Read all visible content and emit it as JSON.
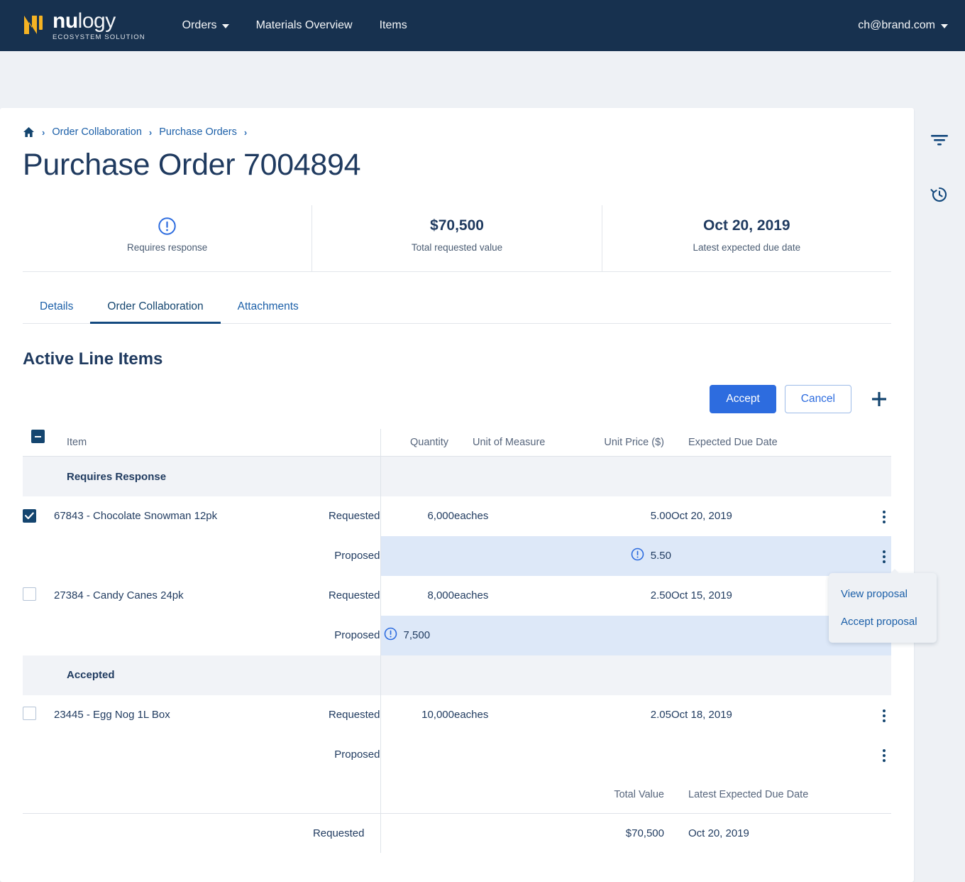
{
  "brand": {
    "name_bold": "nu",
    "name_light": "logy",
    "tagline": "ECOSYSTEM SOLUTION",
    "logo_icon": "nulogy-mark-icon",
    "accent": "#f5b323"
  },
  "topnav": {
    "links": [
      {
        "label": "Orders",
        "has_caret": true
      },
      {
        "label": "Materials Overview",
        "has_caret": false
      },
      {
        "label": "Items",
        "has_caret": false
      }
    ],
    "account": "ch@brand.com",
    "account_caret_icon": "chevron-down-icon",
    "background": "#17314f"
  },
  "breadcrumb": {
    "home_icon": "home-icon",
    "separator": "›",
    "items": [
      "Order Collaboration",
      "Purchase Orders"
    ]
  },
  "page": {
    "title": "Purchase Order 7004894"
  },
  "summary": [
    {
      "icon": "alert-circle-icon",
      "value": "",
      "label": "Requires response"
    },
    {
      "icon": "",
      "value": "$70,500",
      "label": "Total requested value"
    },
    {
      "icon": "",
      "value": "Oct 20, 2019",
      "label": "Latest expected due date"
    }
  ],
  "tabs": [
    {
      "label": "Details",
      "active": false
    },
    {
      "label": "Order Collaboration",
      "active": true
    },
    {
      "label": "Attachments",
      "active": false
    }
  ],
  "section": {
    "title": "Active Line Items"
  },
  "toolbar": {
    "accept_label": "Accept",
    "cancel_label": "Cancel",
    "add_icon": "plus-icon",
    "accept_color": "#2d6cdf"
  },
  "table": {
    "headers": {
      "item": "Item",
      "quantity": "Quantity",
      "uom": "Unit of Measure",
      "unit_price": "Unit Price ($)",
      "due_date": "Expected Due Date"
    },
    "select_all_state": "indeterminate",
    "groups": [
      {
        "name": "Requires Response",
        "rows": [
          {
            "checked": true,
            "item": "67843 - Chocolate Snowman 12pk",
            "requested": {
              "state": "Requested",
              "quantity": "6,000",
              "uom": "eaches",
              "unit_price": "5.00",
              "due_date": "Oct 20, 2019"
            },
            "proposed": {
              "state": "Proposed",
              "quantity": "",
              "quantity_alert": false,
              "uom": "",
              "unit_price": "5.50",
              "price_alert": true,
              "due_date": "",
              "highlighted": true
            }
          },
          {
            "checked": false,
            "item": "27384 - Candy Canes 24pk",
            "requested": {
              "state": "Requested",
              "quantity": "8,000",
              "uom": "eaches",
              "unit_price": "2.50",
              "due_date": "Oct 15, 2019"
            },
            "proposed": {
              "state": "Proposed",
              "quantity": "7,500",
              "quantity_alert": true,
              "uom": "",
              "unit_price": "",
              "price_alert": false,
              "due_date": "",
              "highlighted": true
            }
          }
        ]
      },
      {
        "name": "Accepted",
        "rows": [
          {
            "checked": false,
            "item": "23445 - Egg Nog 1L Box",
            "requested": {
              "state": "Requested",
              "quantity": "10,000",
              "uom": "eaches",
              "unit_price": "2.05",
              "due_date": "Oct 18, 2019"
            },
            "proposed": {
              "state": "Proposed",
              "quantity": "",
              "quantity_alert": false,
              "uom": "",
              "unit_price": "",
              "price_alert": false,
              "due_date": "",
              "highlighted": false
            }
          }
        ]
      }
    ]
  },
  "totals": {
    "headers": {
      "total_value": "Total Value",
      "latest_due": "Latest Expected Due Date"
    },
    "rows": [
      {
        "label": "Requested",
        "total_value": "$70,500",
        "latest_due": "Oct 20, 2019"
      }
    ]
  },
  "popover": {
    "items": [
      "View proposal",
      "Accept proposal"
    ]
  },
  "rail": {
    "filter_icon": "filter-icon",
    "history_icon": "history-icon"
  },
  "icons": {
    "kebab": "kebab-menu-icon",
    "alert": "alert-circle-icon"
  }
}
